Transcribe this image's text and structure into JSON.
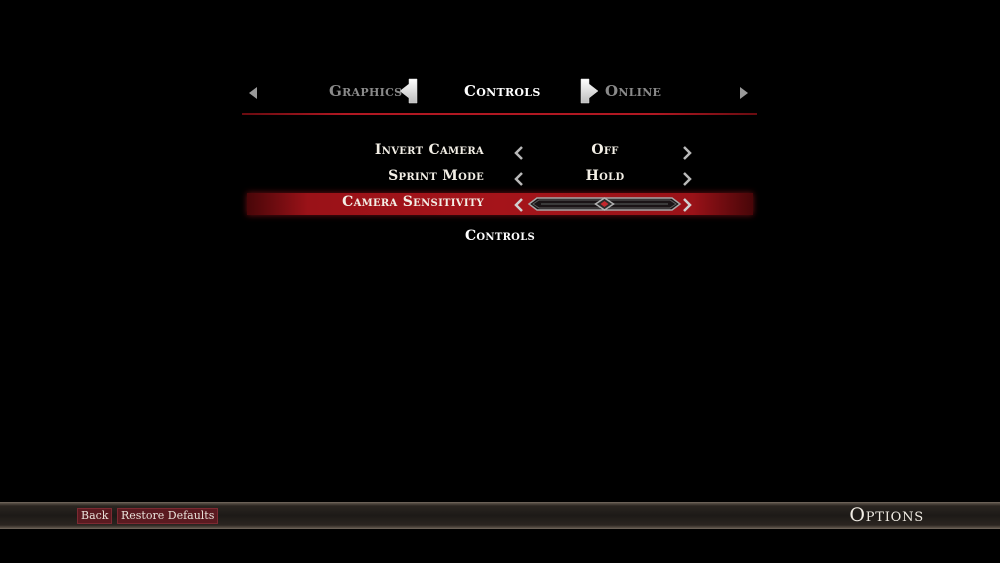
{
  "tabs": {
    "prev": "Graphics",
    "active": "Controls",
    "next": "Online"
  },
  "settings": [
    {
      "label": "Invert Camera",
      "value": "Off"
    },
    {
      "label": "Sprint Mode",
      "value": "Hold"
    },
    {
      "label": "Camera Sensitivity",
      "value": 0.5
    }
  ],
  "section_label": "Controls",
  "footer": {
    "back_label": "Back",
    "restore_label": "Restore Defaults",
    "screen_title": "Options"
  },
  "colors": {
    "accent_red": "#a5141a",
    "text": "#f2efe8",
    "dim_text": "#8a8a8a"
  },
  "icons": {
    "tab_scroll": "triangle-icon",
    "tab_arrow": "arrow-icon",
    "row_chevron": "chevron-icon",
    "slider": "ornate-slider"
  }
}
